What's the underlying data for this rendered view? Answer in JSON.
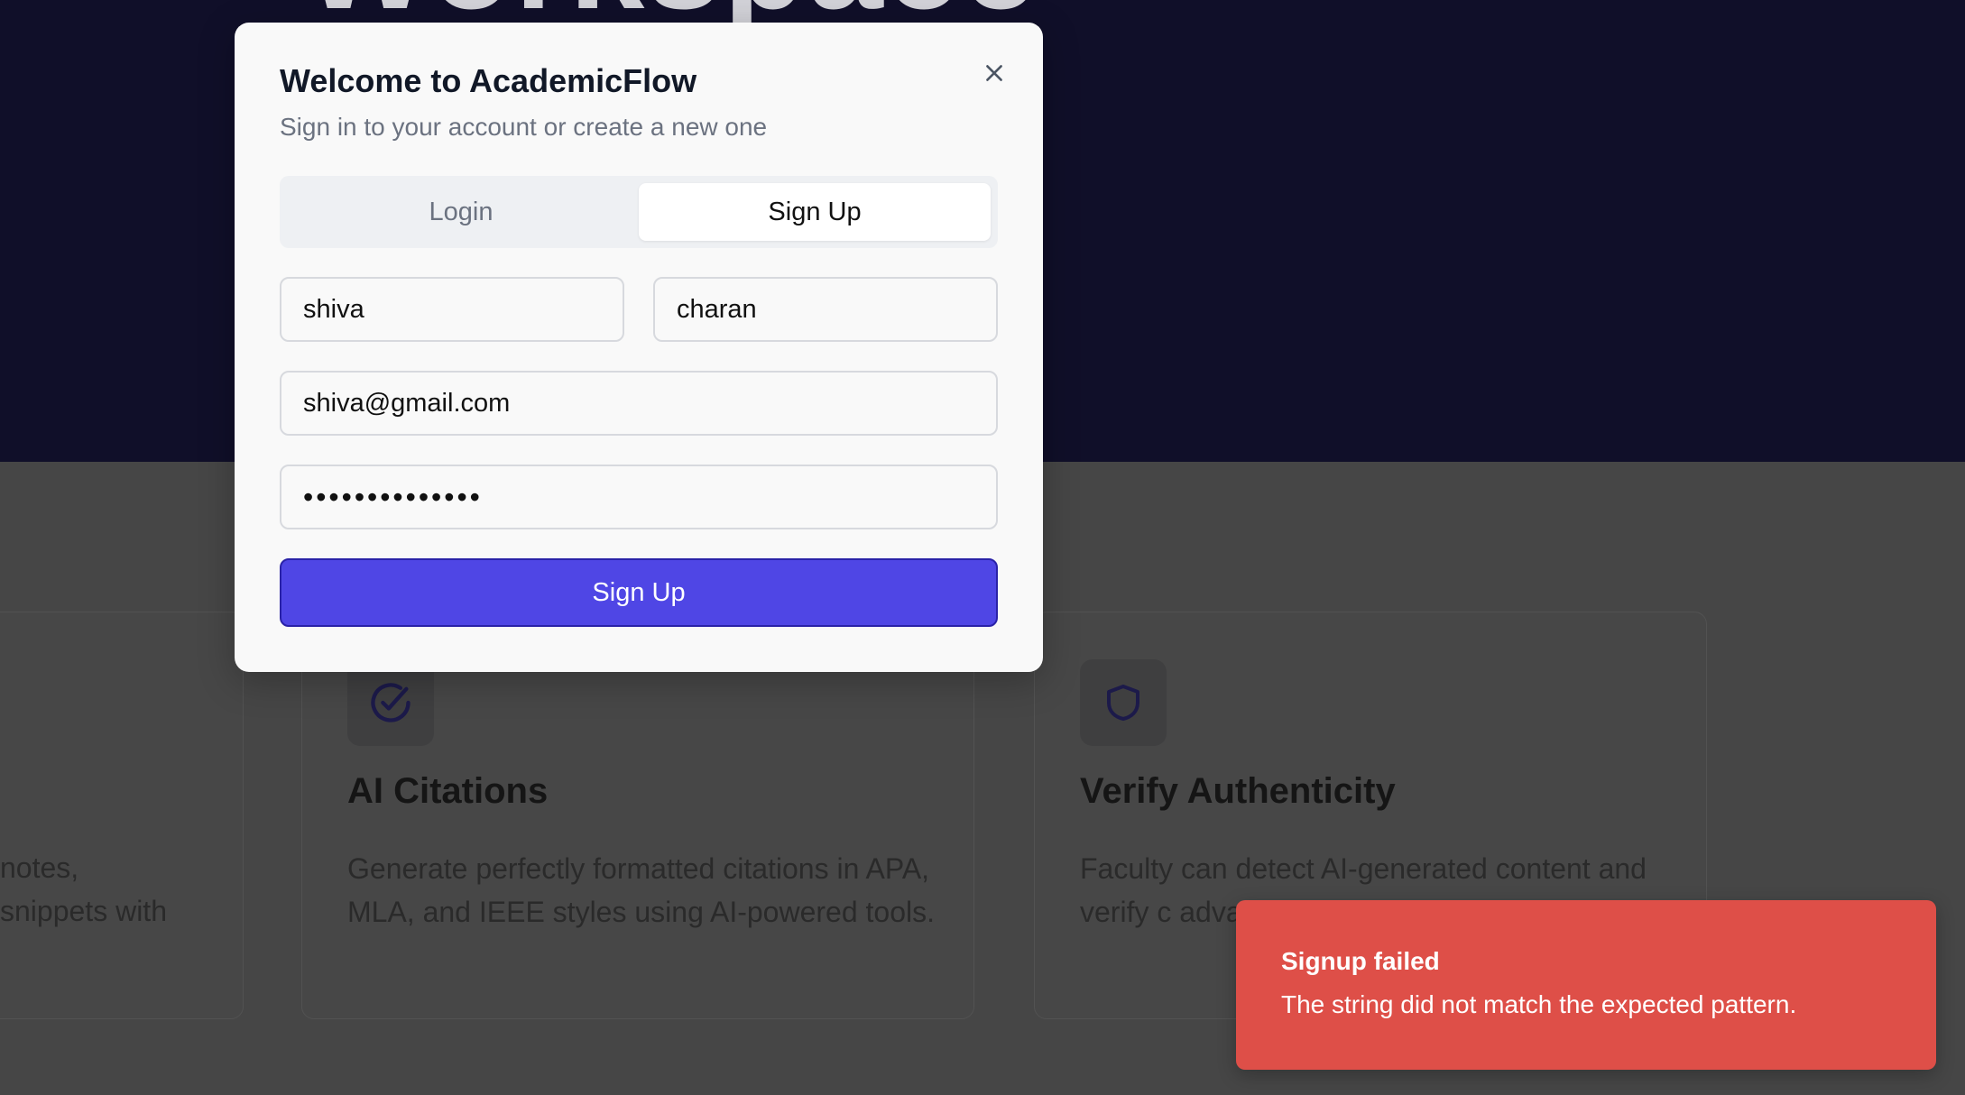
{
  "hero": {
    "title_fragment": "Workspace"
  },
  "features": {
    "left_card_text": "notes,\nsnippets with",
    "cards": [
      {
        "icon": "check-circle-icon",
        "title": "AI Citations",
        "description": "Generate perfectly formatted citations in APA, MLA, and IEEE styles using AI-powered tools."
      },
      {
        "icon": "shield-icon",
        "title": "Verify Authenticity",
        "description": "Faculty can detect AI-generated content and verify c advanced t"
      }
    ]
  },
  "modal": {
    "title": "Welcome to AcademicFlow",
    "subtitle": "Sign in to your account or create a new one",
    "tabs": {
      "login": "Login",
      "signup": "Sign Up",
      "active": "signup"
    },
    "fields": {
      "first_name": "shiva",
      "last_name": "charan",
      "email": "shiva@gmail.com",
      "password_mask": "••••••••••••••"
    },
    "submit_label": "Sign Up"
  },
  "toast": {
    "title": "Signup failed",
    "message": "The string did not match the expected pattern."
  },
  "colors": {
    "primary": "#4f46e5",
    "toast_error": "#de4f48",
    "hero_bg": "#100f29",
    "overlay_bg": "#464646"
  }
}
